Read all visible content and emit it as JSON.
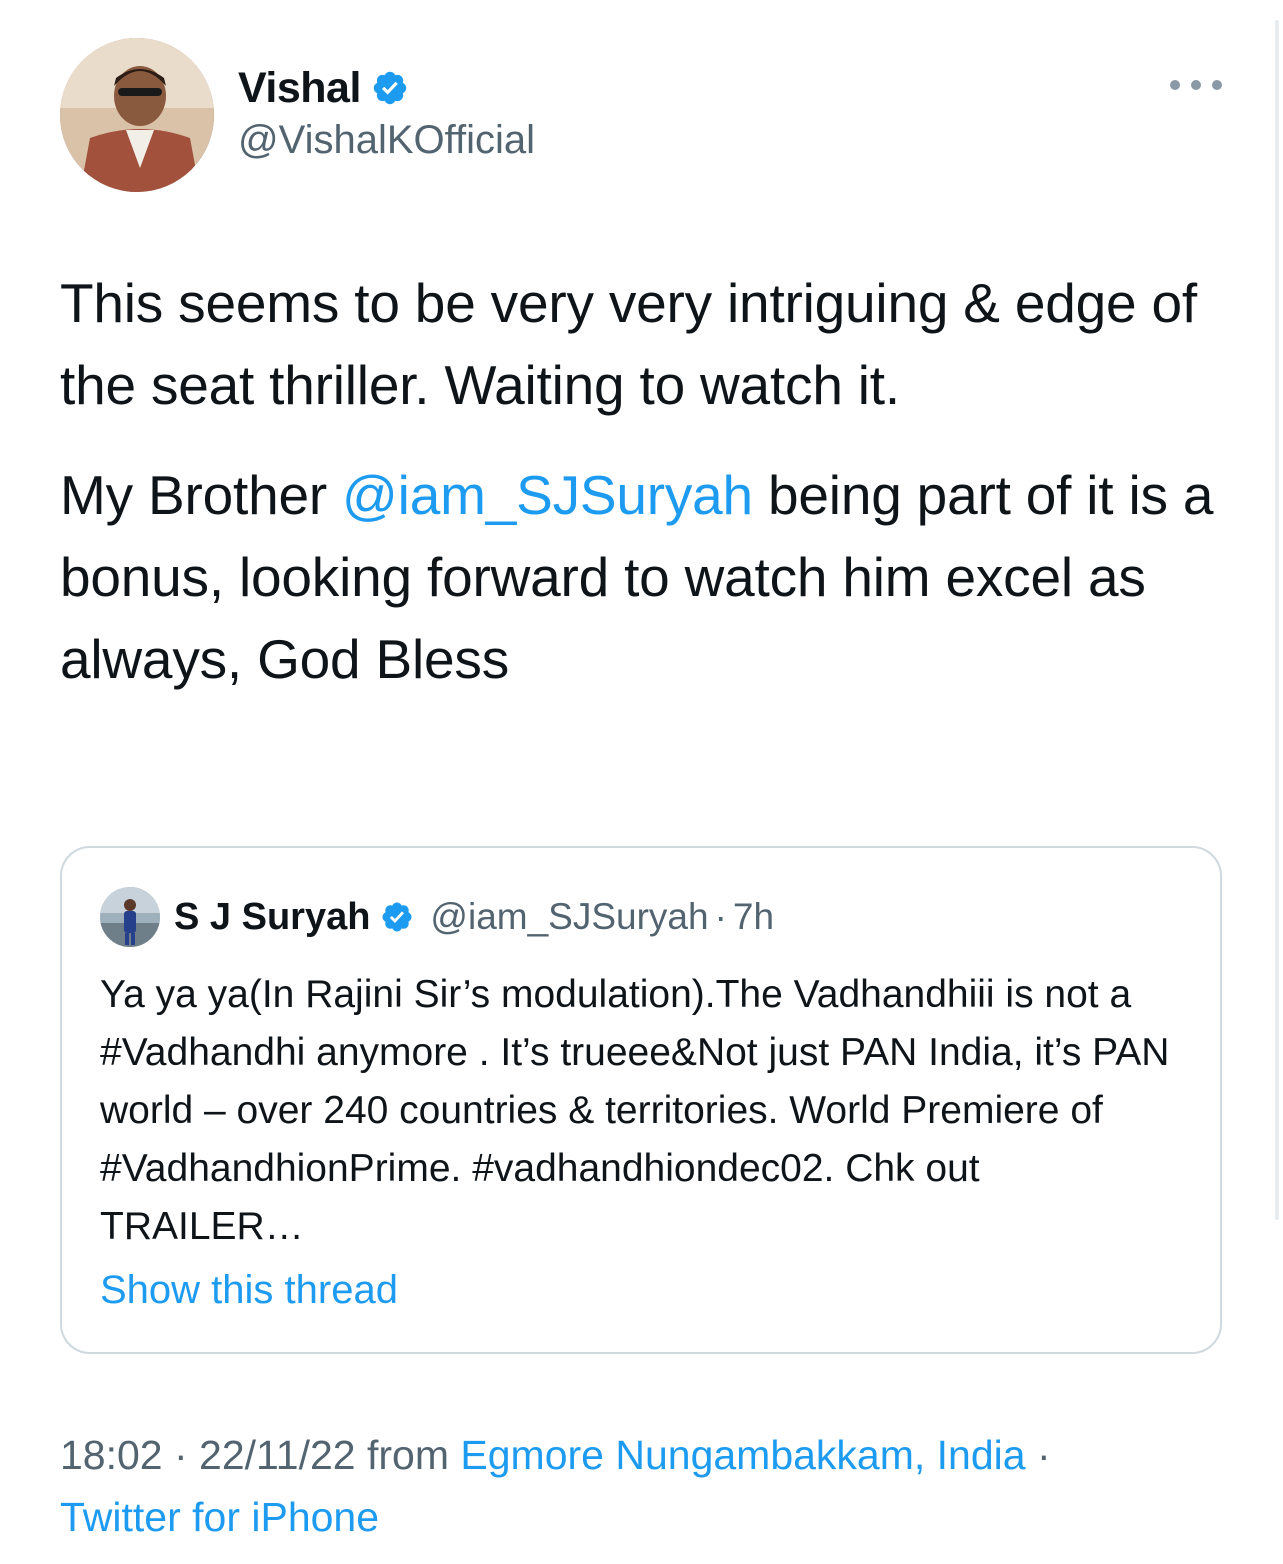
{
  "author": {
    "name": "Vishal",
    "handle": "@VishalKOfficial",
    "verified": true
  },
  "tweet": {
    "para1": "This seems to be very very intriguing & edge of the seat thriller. Waiting to watch it.",
    "para2_before": "My Brother ",
    "para2_mention": "@iam_SJSuryah",
    "para2_after": " being part of it is a bonus, looking forward to watch him excel as always, God Bless"
  },
  "quoted": {
    "name": "S J Suryah",
    "handle": "@iam_SJSuryah",
    "separator": "·",
    "time": "7h",
    "text": "Ya ya ya(In Rajini Sir’s modulation).The Vadhandhiii is not a #Vadhandhi anymore . It’s trueee&Not just PAN India, it’s PAN world – over 240 countries & territories. World Premiere of #VadhandhionPrime. #vadhandhiondec02. Chk out TRAILER…",
    "show_thread": "Show this thread"
  },
  "meta": {
    "time": "18:02",
    "sep1": " · ",
    "date": "22/11/22",
    "from": " from ",
    "location": "Egmore Nungambakkam, India",
    "sep2": " · ",
    "client": "Twitter for iPhone"
  },
  "colors": {
    "link": "#1d9bf0",
    "secondary_text": "#536471",
    "border": "#cfd9de"
  },
  "icons": {
    "verified": "verified-badge-icon",
    "more": "more-options-icon"
  }
}
